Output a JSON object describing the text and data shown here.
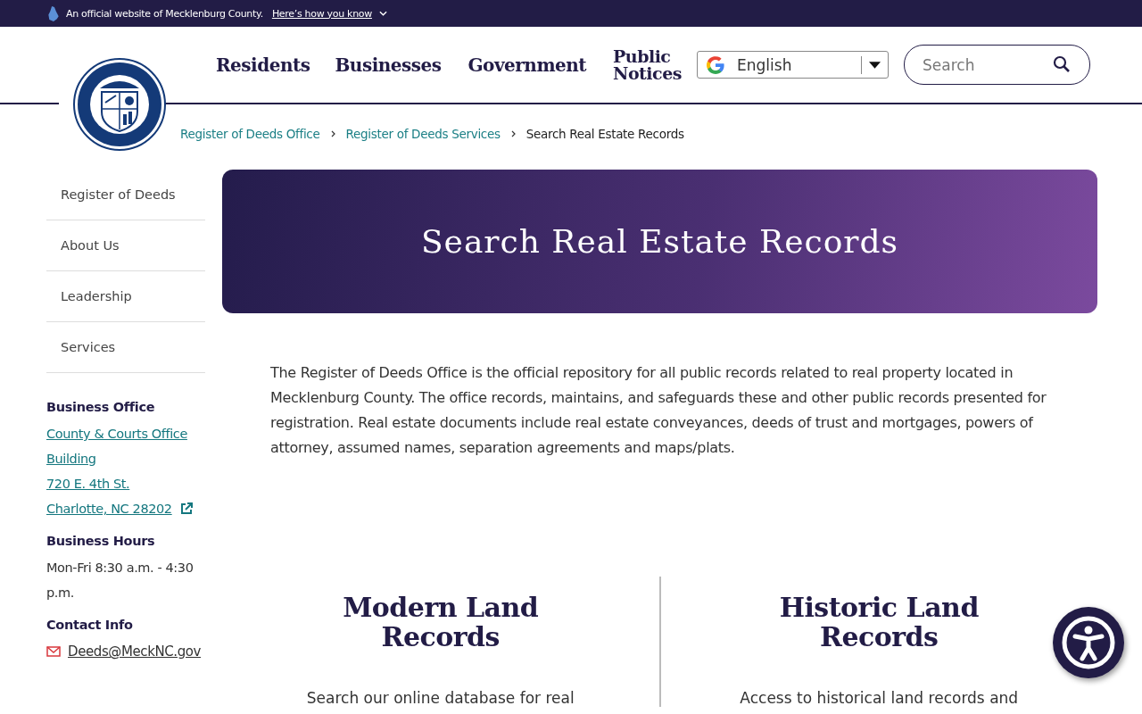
{
  "official_banner": {
    "text": "An official website of Mecklenburg County.",
    "link": "Here’s how you know"
  },
  "nav": [
    "Residents",
    "Businesses",
    "Government",
    "Public Notices"
  ],
  "language_select": {
    "value": "English"
  },
  "search": {
    "placeholder": "Search"
  },
  "breadcrumb": [
    {
      "label": "Register of Deeds Office",
      "link": true
    },
    {
      "label": "Register of Deeds Services",
      "link": true
    },
    {
      "label": "Search Real Estate Records",
      "link": false
    }
  ],
  "sidebar": {
    "items": [
      "Register of Deeds",
      "About Us",
      "Leadership",
      "Services"
    ],
    "sections": [
      {
        "heading": "Business Office",
        "kind": "address",
        "lines": [
          "County & Courts Office Building",
          "720 E. 4th St.",
          "Charlotte, NC 28202"
        ]
      },
      {
        "heading": "Business Hours",
        "kind": "text",
        "lines": [
          "Mon-Fri 8:30 a.m. - 4:30 p.m."
        ]
      },
      {
        "heading": "Contact Info",
        "kind": "email",
        "lines": [
          "Deeds@MeckNC.gov"
        ]
      }
    ]
  },
  "hero": {
    "title": "Search Real Estate Records"
  },
  "intro": "The Register of Deeds Office is the official repository for all public records related to real property located in Mecklenburg County.  The office records, maintains, and safeguards these and other public records presented for registration. Real estate documents include real estate conveyances, deeds of trust and mortgages, powers of attorney, assumed names, separation agreements and maps/plats.",
  "columns": [
    {
      "title": "Modern Land Records",
      "text": "Search our online database for real"
    },
    {
      "title": "Historic Land Records",
      "text": "Access to historical land records and"
    }
  ]
}
